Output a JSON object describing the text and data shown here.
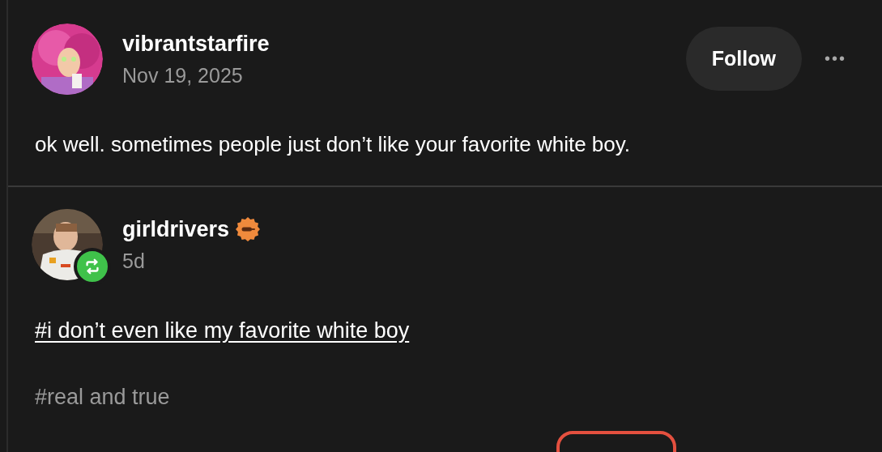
{
  "posts": [
    {
      "kind": "original",
      "author": "vibrantstarfire",
      "date": "Nov 19, 2025",
      "follow_button": "Follow",
      "more_button": "•••",
      "body": "ok well. sometimes people just don’t like your favorite white boy."
    },
    {
      "kind": "reblog",
      "author": "girldrivers",
      "verified_badge": true,
      "date": "5d",
      "tags": [
        {
          "text": "#i don’t even like my favorite white boy",
          "kind": "link"
        },
        {
          "text": "#real and true",
          "kind": "plain"
        }
      ]
    }
  ]
}
